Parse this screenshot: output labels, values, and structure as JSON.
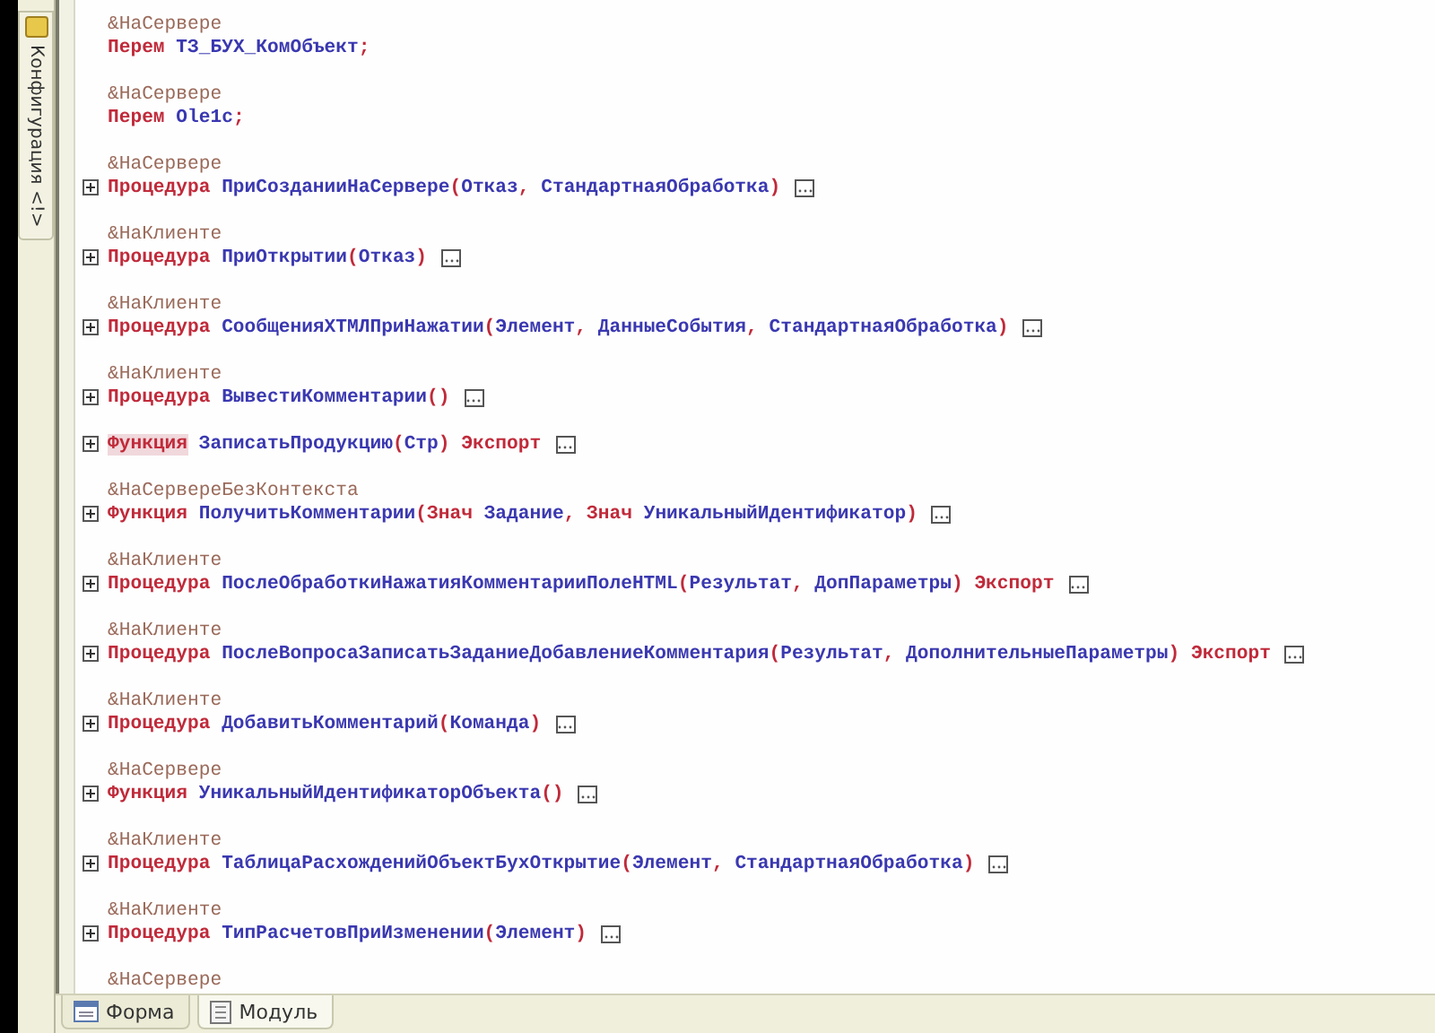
{
  "side_panel": {
    "tab": "Конфигурация <!>"
  },
  "module": {
    "blocks": [
      {
        "directive": "&НаСервере",
        "collapsed": false,
        "tokens": [
          {
            "kind": "keyword",
            "text": "Перем "
          },
          {
            "kind": "ident",
            "text": "ТЗ_БУХ_КомОбъект"
          },
          {
            "kind": "op",
            "text": ";"
          }
        ]
      },
      {
        "directive": "&НаСервере",
        "collapsed": false,
        "tokens": [
          {
            "kind": "keyword",
            "text": "Перем "
          },
          {
            "kind": "ident",
            "text": "Ole1c"
          },
          {
            "kind": "op",
            "text": ";"
          }
        ]
      },
      {
        "directive": "&НаСервере",
        "collapsed": true,
        "tokens": [
          {
            "kind": "keyword",
            "text": "Процедура "
          },
          {
            "kind": "ident",
            "text": "ПриСозданииНаСервере"
          },
          {
            "kind": "op",
            "text": "("
          },
          {
            "kind": "ident",
            "text": "Отказ"
          },
          {
            "kind": "op",
            "text": ", "
          },
          {
            "kind": "ident",
            "text": "СтандартнаяОбработка"
          },
          {
            "kind": "op",
            "text": ")"
          }
        ]
      },
      {
        "directive": "&НаКлиенте",
        "collapsed": true,
        "tokens": [
          {
            "kind": "keyword",
            "text": "Процедура "
          },
          {
            "kind": "ident",
            "text": "ПриОткрытии"
          },
          {
            "kind": "op",
            "text": "("
          },
          {
            "kind": "ident",
            "text": "Отказ"
          },
          {
            "kind": "op",
            "text": ")"
          }
        ]
      },
      {
        "directive": "&НаКлиенте",
        "collapsed": true,
        "tokens": [
          {
            "kind": "keyword",
            "text": "Процедура "
          },
          {
            "kind": "ident",
            "text": "СообщенияХТМЛПриНажатии"
          },
          {
            "kind": "op",
            "text": "("
          },
          {
            "kind": "ident",
            "text": "Элемент"
          },
          {
            "kind": "op",
            "text": ", "
          },
          {
            "kind": "ident",
            "text": "ДанныеСобытия"
          },
          {
            "kind": "op",
            "text": ", "
          },
          {
            "kind": "ident",
            "text": "СтандартнаяОбработка"
          },
          {
            "kind": "op",
            "text": ")"
          }
        ]
      },
      {
        "directive": "&НаКлиенте",
        "collapsed": true,
        "tokens": [
          {
            "kind": "keyword",
            "text": "Процедура "
          },
          {
            "kind": "ident",
            "text": "ВывестиКомментарии"
          },
          {
            "kind": "op",
            "text": "()"
          }
        ]
      },
      {
        "collapsed": true,
        "tokens": [
          {
            "kind": "keyword",
            "text": "Функция",
            "highlighted": true
          },
          {
            "kind": "ident",
            "text": " ЗаписатьПродукцию"
          },
          {
            "kind": "op",
            "text": "("
          },
          {
            "kind": "ident",
            "text": "Стр"
          },
          {
            "kind": "op",
            "text": ") "
          },
          {
            "kind": "keyword",
            "text": "Экспорт"
          }
        ]
      },
      {
        "directive": "&НаСервереБезКонтекста",
        "collapsed": true,
        "tokens": [
          {
            "kind": "keyword",
            "text": "Функция "
          },
          {
            "kind": "ident",
            "text": "ПолучитьКомментарии"
          },
          {
            "kind": "op",
            "text": "("
          },
          {
            "kind": "keyword",
            "text": "Знач "
          },
          {
            "kind": "ident",
            "text": "Задание"
          },
          {
            "kind": "op",
            "text": ", "
          },
          {
            "kind": "keyword",
            "text": "Знач "
          },
          {
            "kind": "ident",
            "text": "УникальныйИдентификатор"
          },
          {
            "kind": "op",
            "text": ")"
          }
        ]
      },
      {
        "directive": "&НаКлиенте",
        "collapsed": true,
        "tokens": [
          {
            "kind": "keyword",
            "text": "Процедура "
          },
          {
            "kind": "ident",
            "text": "ПослеОбработкиНажатияКомментарииПолеHTML"
          },
          {
            "kind": "op",
            "text": "("
          },
          {
            "kind": "ident",
            "text": "Результат"
          },
          {
            "kind": "op",
            "text": ", "
          },
          {
            "kind": "ident",
            "text": "ДопПараметры"
          },
          {
            "kind": "op",
            "text": ") "
          },
          {
            "kind": "keyword",
            "text": "Экспорт"
          }
        ]
      },
      {
        "directive": "&НаКлиенте",
        "collapsed": true,
        "tokens": [
          {
            "kind": "keyword",
            "text": "Процедура "
          },
          {
            "kind": "ident",
            "text": "ПослеВопросаЗаписатьЗаданиеДобавлениеКомментария"
          },
          {
            "kind": "op",
            "text": "("
          },
          {
            "kind": "ident",
            "text": "Результат"
          },
          {
            "kind": "op",
            "text": ", "
          },
          {
            "kind": "ident",
            "text": "ДополнительныеПараметры"
          },
          {
            "kind": "op",
            "text": ") "
          },
          {
            "kind": "keyword",
            "text": "Экспорт"
          }
        ]
      },
      {
        "directive": "&НаКлиенте",
        "collapsed": true,
        "tokens": [
          {
            "kind": "keyword",
            "text": "Процедура "
          },
          {
            "kind": "ident",
            "text": "ДобавитьКомментарий"
          },
          {
            "kind": "op",
            "text": "("
          },
          {
            "kind": "ident",
            "text": "Команда"
          },
          {
            "kind": "op",
            "text": ")"
          }
        ]
      },
      {
        "directive": "&НаСервере",
        "collapsed": true,
        "tokens": [
          {
            "kind": "keyword",
            "text": "Функция "
          },
          {
            "kind": "ident",
            "text": "УникальныйИдентификаторОбъекта"
          },
          {
            "kind": "op",
            "text": "()"
          }
        ]
      },
      {
        "directive": "&НаКлиенте",
        "collapsed": true,
        "tokens": [
          {
            "kind": "keyword",
            "text": "Процедура "
          },
          {
            "kind": "ident",
            "text": "ТаблицаРасхожденийОбъектБухОткрытие"
          },
          {
            "kind": "op",
            "text": "("
          },
          {
            "kind": "ident",
            "text": "Элемент"
          },
          {
            "kind": "op",
            "text": ", "
          },
          {
            "kind": "ident",
            "text": "СтандартнаяОбработка"
          },
          {
            "kind": "op",
            "text": ")"
          }
        ]
      },
      {
        "directive": "&НаКлиенте",
        "collapsed": true,
        "tokens": [
          {
            "kind": "keyword",
            "text": "Процедура "
          },
          {
            "kind": "ident",
            "text": "ТипРасчетовПриИзменении"
          },
          {
            "kind": "op",
            "text": "("
          },
          {
            "kind": "ident",
            "text": "Элемент"
          },
          {
            "kind": "op",
            "text": ")"
          }
        ]
      },
      {
        "directive": "&НаСервере"
      }
    ]
  },
  "bottom_tabs": [
    {
      "label": "Форма",
      "selected": false
    },
    {
      "label": "Модуль",
      "selected": true
    }
  ]
}
